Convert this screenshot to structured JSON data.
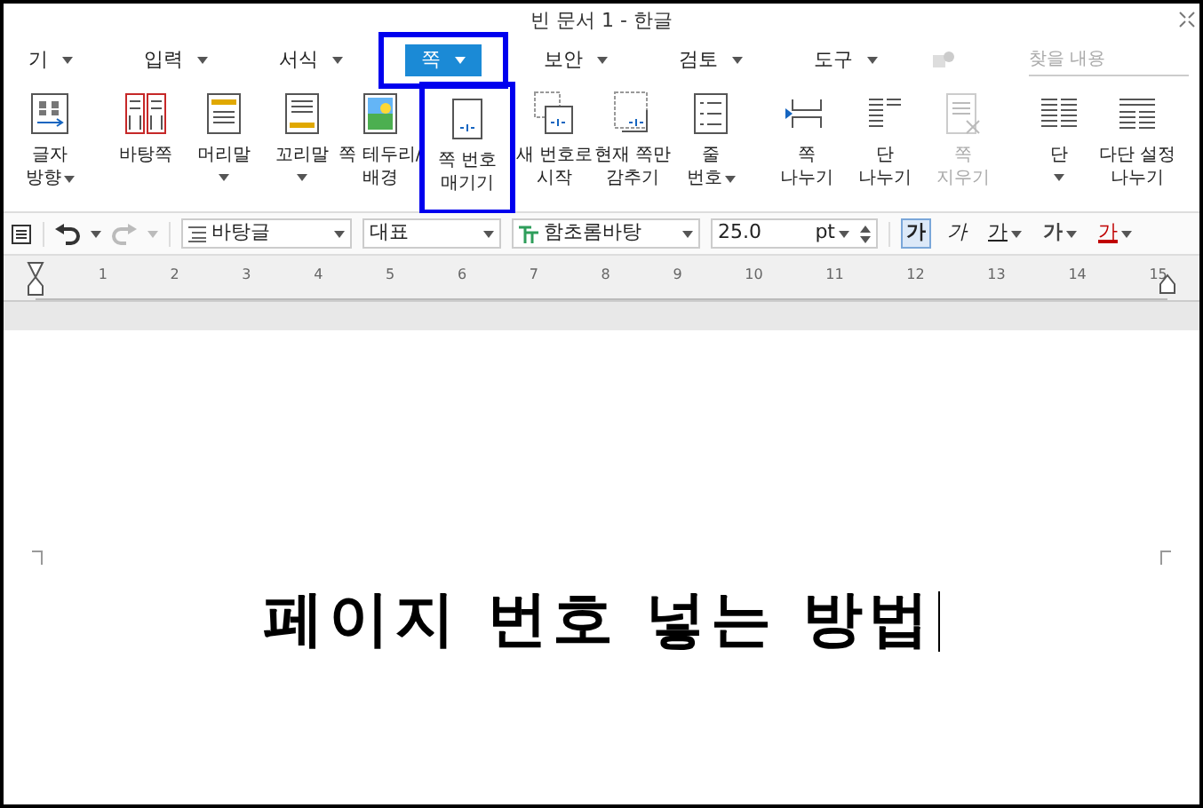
{
  "window": {
    "title": "빈 문서 1 - 한글"
  },
  "menu": [
    {
      "label": "기",
      "selected": false,
      "highlighted": false
    },
    {
      "label": "입력",
      "selected": false,
      "highlighted": false
    },
    {
      "label": "서식",
      "selected": false,
      "highlighted": false
    },
    {
      "label": "쪽",
      "selected": true,
      "highlighted": true
    },
    {
      "label": "보안",
      "selected": false,
      "highlighted": false
    },
    {
      "label": "검토",
      "selected": false,
      "highlighted": false
    },
    {
      "label": "도구",
      "selected": false,
      "highlighted": false
    }
  ],
  "search": {
    "placeholder": "찾을 내용"
  },
  "ribbon": [
    {
      "buttons": [
        {
          "kind": "direction",
          "lines": [
            "글자",
            "방향"
          ],
          "dropdown": true,
          "caret_inline": true,
          "disabled": false,
          "highlighted": false
        }
      ]
    },
    {
      "buttons": [
        {
          "kind": "masterpage",
          "lines": [
            "바탕쪽"
          ],
          "dropdown": false,
          "disabled": false,
          "highlighted": false
        },
        {
          "kind": "header",
          "lines": [
            "머리말"
          ],
          "dropdown": true,
          "caret_inline": false,
          "disabled": false,
          "highlighted": false
        },
        {
          "kind": "footer",
          "lines": [
            "꼬리말"
          ],
          "dropdown": true,
          "caret_inline": false,
          "disabled": false,
          "highlighted": false
        },
        {
          "kind": "border",
          "lines": [
            "쪽 테두리/",
            "배경"
          ],
          "dropdown": false,
          "disabled": false,
          "highlighted": false
        },
        {
          "kind": "pagenum",
          "lines": [
            "쪽 번호",
            "매기기"
          ],
          "dropdown": false,
          "disabled": false,
          "highlighted": true
        },
        {
          "kind": "newnum",
          "lines": [
            "새 번호로",
            "시작"
          ],
          "dropdown": false,
          "disabled": false,
          "highlighted": false
        },
        {
          "kind": "hide",
          "lines": [
            "현재 쪽만",
            "감추기"
          ],
          "dropdown": false,
          "disabled": false,
          "highlighted": false
        },
        {
          "kind": "linenum",
          "lines": [
            "줄",
            "번호"
          ],
          "dropdown": true,
          "caret_inline": true,
          "disabled": false,
          "highlighted": false
        }
      ]
    },
    {
      "buttons": [
        {
          "kind": "pagebreak",
          "lines": [
            "쪽",
            "나누기"
          ],
          "dropdown": false,
          "disabled": false,
          "highlighted": false
        },
        {
          "kind": "colbreak",
          "lines": [
            "단",
            "나누기"
          ],
          "dropdown": false,
          "disabled": false,
          "highlighted": false
        },
        {
          "kind": "delete",
          "lines": [
            "쪽",
            "지우기"
          ],
          "dropdown": false,
          "disabled": true,
          "highlighted": false
        }
      ]
    },
    {
      "buttons": [
        {
          "kind": "columns",
          "lines": [
            "단"
          ],
          "dropdown": true,
          "caret_inline": false,
          "disabled": false,
          "highlighted": false
        },
        {
          "kind": "multicol",
          "lines": [
            "다단 설정",
            "나누기"
          ],
          "dropdown": false,
          "disabled": false,
          "highlighted": false
        }
      ]
    }
  ],
  "format_bar": {
    "style": "바탕글",
    "language": "대표",
    "font": "함초롬바탕",
    "size": "25.0",
    "unit": "pt",
    "char_buttons": [
      {
        "label": "가",
        "kind": "bold",
        "selected": true,
        "dropdown": false
      },
      {
        "label": "가",
        "kind": "italic",
        "selected": false,
        "dropdown": false
      },
      {
        "label": "가",
        "kind": "underline",
        "selected": false,
        "dropdown": true
      },
      {
        "label": "가",
        "kind": "outline",
        "selected": false,
        "dropdown": true
      },
      {
        "label": "가",
        "kind": "color",
        "selected": false,
        "dropdown": true
      }
    ]
  },
  "ruler": {
    "ticks": [
      "1",
      "2",
      "3",
      "4",
      "5",
      "6",
      "7",
      "8",
      "9",
      "10",
      "11",
      "12",
      "13",
      "14",
      "15"
    ]
  },
  "document": {
    "text": "페이지 번호 넣는 방법"
  }
}
